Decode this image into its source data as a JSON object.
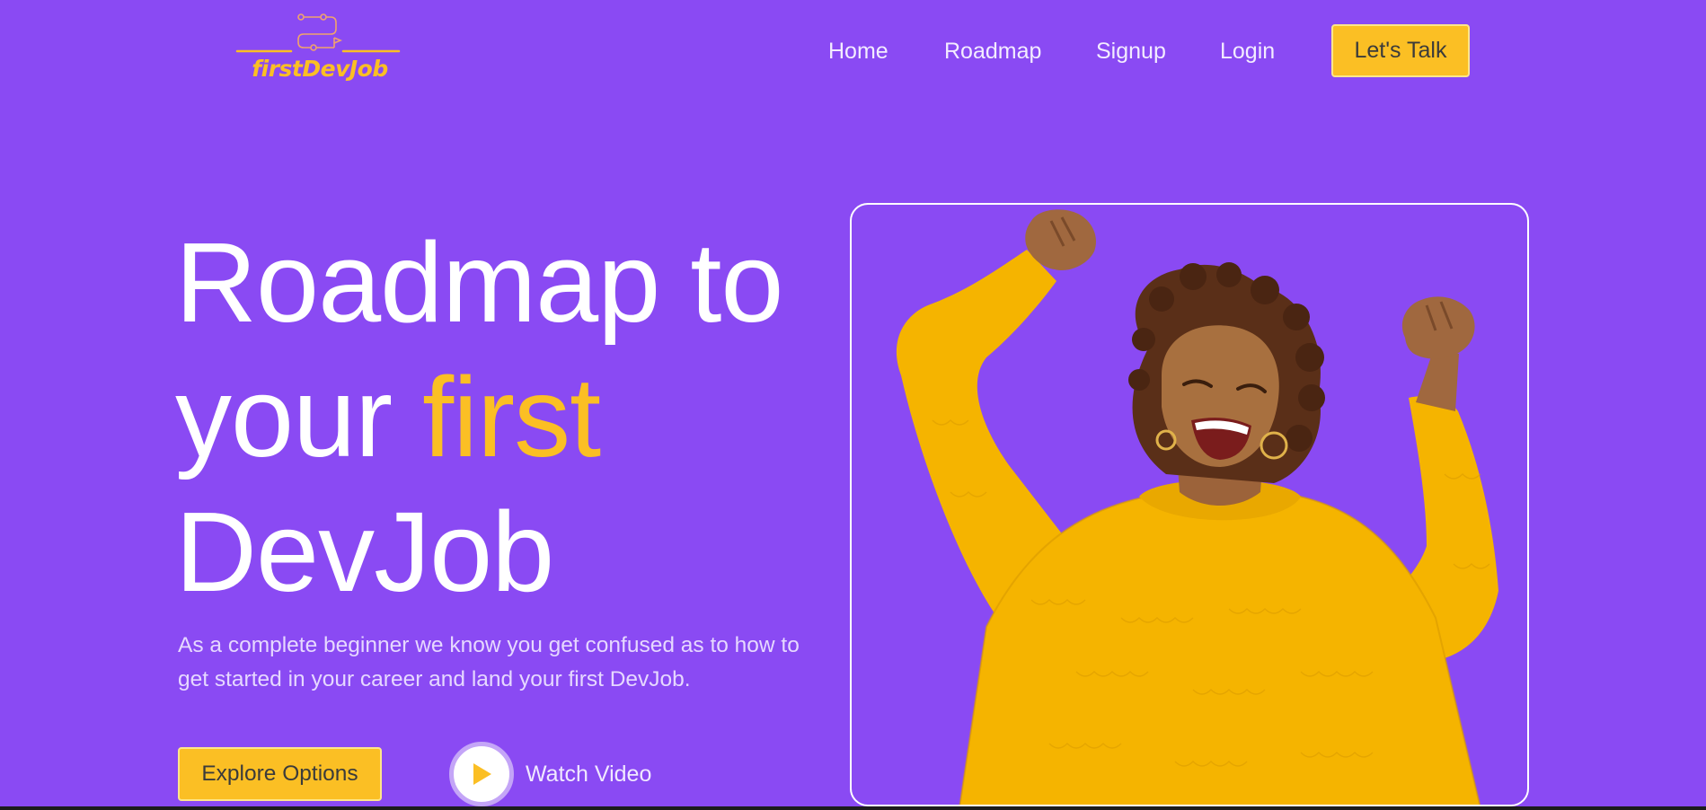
{
  "brand": {
    "name": "firstDevJob",
    "color": "#fbbf24"
  },
  "nav": {
    "items": [
      "Home",
      "Roadmap",
      "Signup",
      "Login"
    ],
    "cta_label": "Let's Talk"
  },
  "hero": {
    "title_line1": "Roadmap to",
    "title_line2_prefix": "your",
    "title_line2_accent": "first",
    "title_line3": "DevJob",
    "description": "As a complete beginner we know you get confused as to how to get started in your career and land your first DevJob.",
    "explore_label": "Explore Options",
    "watch_label": "Watch Video"
  },
  "colors": {
    "background": "#8a4af3",
    "accent": "#fbbf24",
    "text": "#ffffff"
  },
  "icons": {
    "logo": "circuit-path-logo-icon",
    "play": "play-icon"
  }
}
